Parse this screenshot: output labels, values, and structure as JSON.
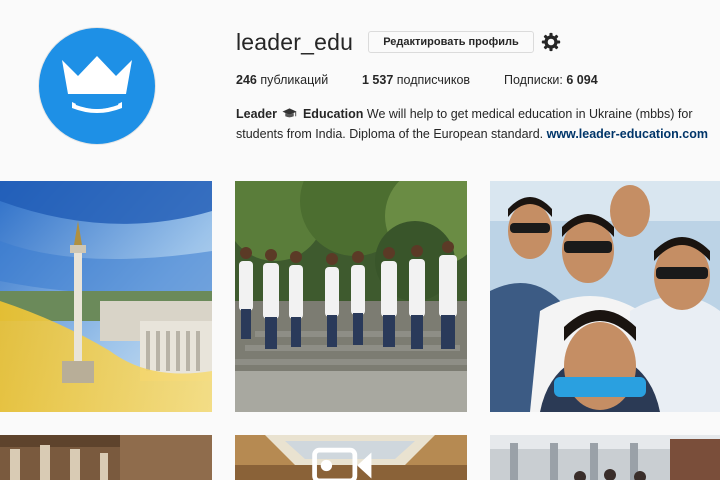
{
  "profile": {
    "username": "leader_edu",
    "edit_profile_label": "Редактировать профиль",
    "settings_icon": "gear-icon",
    "avatar_icon": "crown-logo",
    "brand_color": "#1e90e6"
  },
  "stats": {
    "posts_count": "246",
    "posts_label": "публикаций",
    "followers_count": "1 537",
    "followers_label": "подписчиков",
    "following_label": "Подписки:",
    "following_count": "6 094"
  },
  "bio": {
    "name_part1": "Leader",
    "name_icon": "graduation-cap-icon",
    "name_part2": "Education",
    "text": "We will help to get medical education in Ukraine (mbbs) for students from India. Diploma of the European standard.",
    "link": "www.leader-education.com"
  },
  "posts": [
    {
      "icon": "photo-kyiv-monument"
    },
    {
      "icon": "photo-students-group"
    },
    {
      "icon": "photo-students-selfie"
    },
    {
      "icon": "photo-interior-columns"
    },
    {
      "icon": "video-ceiling",
      "badge_icon": "video-camera-icon"
    },
    {
      "icon": "photo-building-street"
    }
  ]
}
